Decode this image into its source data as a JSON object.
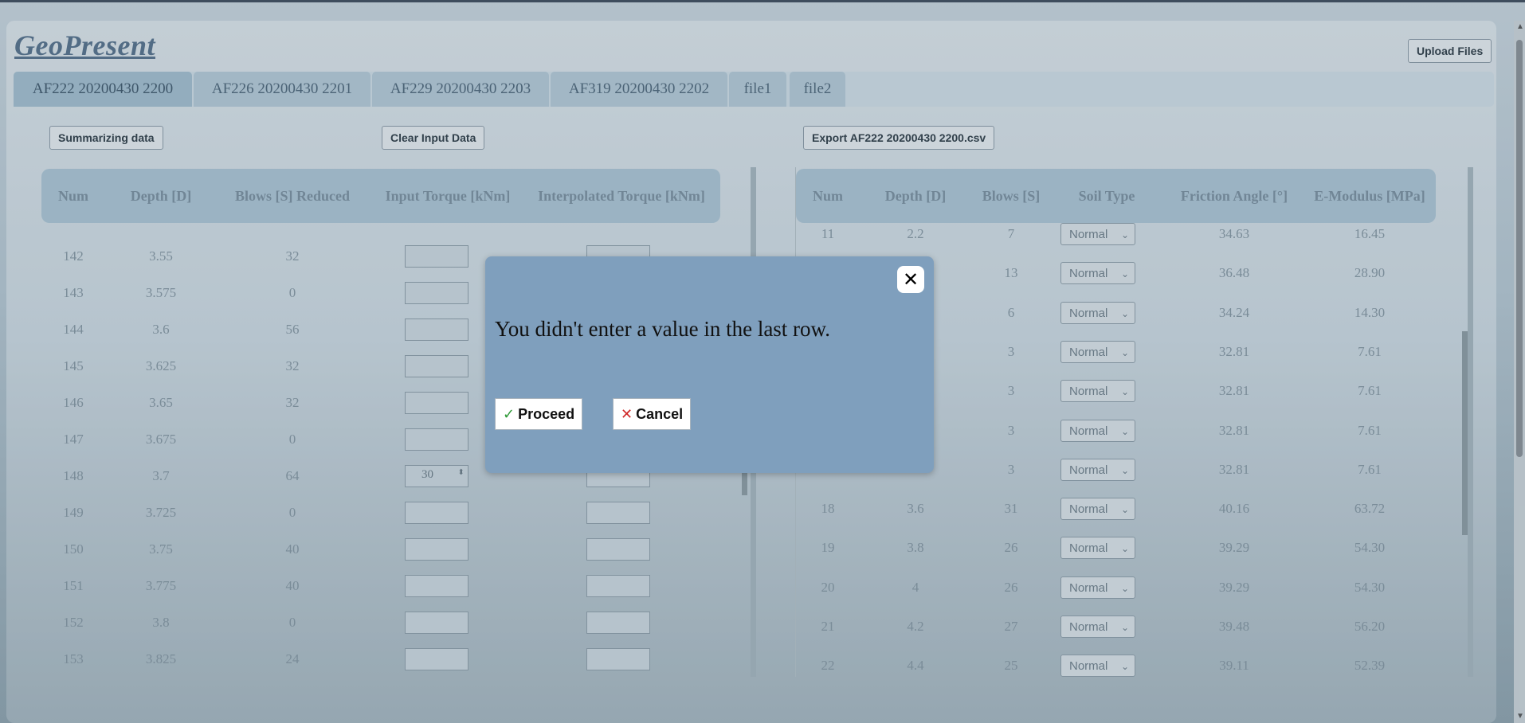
{
  "app": {
    "title": "GeoPresent",
    "upload_label": "Upload Files"
  },
  "tabs": [
    "AF222 20200430 2200",
    "AF226 20200430 2201",
    "AF229 20200430 2203",
    "AF319 20200430 2202",
    "file1",
    "file2"
  ],
  "toolbar": {
    "summarize": "Summarizing data",
    "clear": "Clear Input Data",
    "export": "Export AF222 20200430 2200.csv"
  },
  "left_table": {
    "headers": [
      "Num",
      "Depth [D]",
      "Blows [S] Reduced",
      "Input Torque [kNm]",
      "Interpolated Torque [kNm]"
    ],
    "rows": [
      {
        "num": "142",
        "depth": "3.55",
        "blows": "32"
      },
      {
        "num": "143",
        "depth": "3.575",
        "blows": "0"
      },
      {
        "num": "144",
        "depth": "3.6",
        "blows": "56"
      },
      {
        "num": "145",
        "depth": "3.625",
        "blows": "32"
      },
      {
        "num": "146",
        "depth": "3.65",
        "blows": "32"
      },
      {
        "num": "147",
        "depth": "3.675",
        "blows": "0"
      },
      {
        "num": "148",
        "depth": "3.7",
        "blows": "64",
        "input": "30"
      },
      {
        "num": "149",
        "depth": "3.725",
        "blows": "0"
      },
      {
        "num": "150",
        "depth": "3.75",
        "blows": "40"
      },
      {
        "num": "151",
        "depth": "3.775",
        "blows": "40"
      },
      {
        "num": "152",
        "depth": "3.8",
        "blows": "0"
      },
      {
        "num": "153",
        "depth": "3.825",
        "blows": "24"
      }
    ]
  },
  "right_table": {
    "headers": [
      "Num",
      "Depth [D]",
      "Blows [S]",
      "Soil Type",
      "Friction Angle [°]",
      "E-Modulus [MPa]"
    ],
    "rows": [
      {
        "num": "11",
        "depth": "2.2",
        "blows": "7",
        "soil": "Normal",
        "friction": "34.63",
        "emod": "16.45"
      },
      {
        "num": "",
        "depth": "",
        "blows": "13",
        "soil": "Normal",
        "friction": "36.48",
        "emod": "28.90"
      },
      {
        "num": "",
        "depth": "",
        "blows": "6",
        "soil": "Normal",
        "friction": "34.24",
        "emod": "14.30"
      },
      {
        "num": "",
        "depth": "",
        "blows": "3",
        "soil": "Normal",
        "friction": "32.81",
        "emod": "7.61"
      },
      {
        "num": "",
        "depth": "",
        "blows": "3",
        "soil": "Normal",
        "friction": "32.81",
        "emod": "7.61"
      },
      {
        "num": "",
        "depth": "",
        "blows": "3",
        "soil": "Normal",
        "friction": "32.81",
        "emod": "7.61"
      },
      {
        "num": "",
        "depth": "",
        "blows": "3",
        "soil": "Normal",
        "friction": "32.81",
        "emod": "7.61"
      },
      {
        "num": "18",
        "depth": "3.6",
        "blows": "31",
        "soil": "Normal",
        "friction": "40.16",
        "emod": "63.72"
      },
      {
        "num": "19",
        "depth": "3.8",
        "blows": "26",
        "soil": "Normal",
        "friction": "39.29",
        "emod": "54.30"
      },
      {
        "num": "20",
        "depth": "4",
        "blows": "26",
        "soil": "Normal",
        "friction": "39.29",
        "emod": "54.30"
      },
      {
        "num": "21",
        "depth": "4.2",
        "blows": "27",
        "soil": "Normal",
        "friction": "39.48",
        "emod": "56.20"
      },
      {
        "num": "22",
        "depth": "4.4",
        "blows": "25",
        "soil": "Normal",
        "friction": "39.11",
        "emod": "52.39"
      }
    ]
  },
  "modal": {
    "message": "You didn't enter a value in the last row.",
    "proceed": "Proceed",
    "cancel": "Cancel",
    "close_glyph": "✕"
  }
}
